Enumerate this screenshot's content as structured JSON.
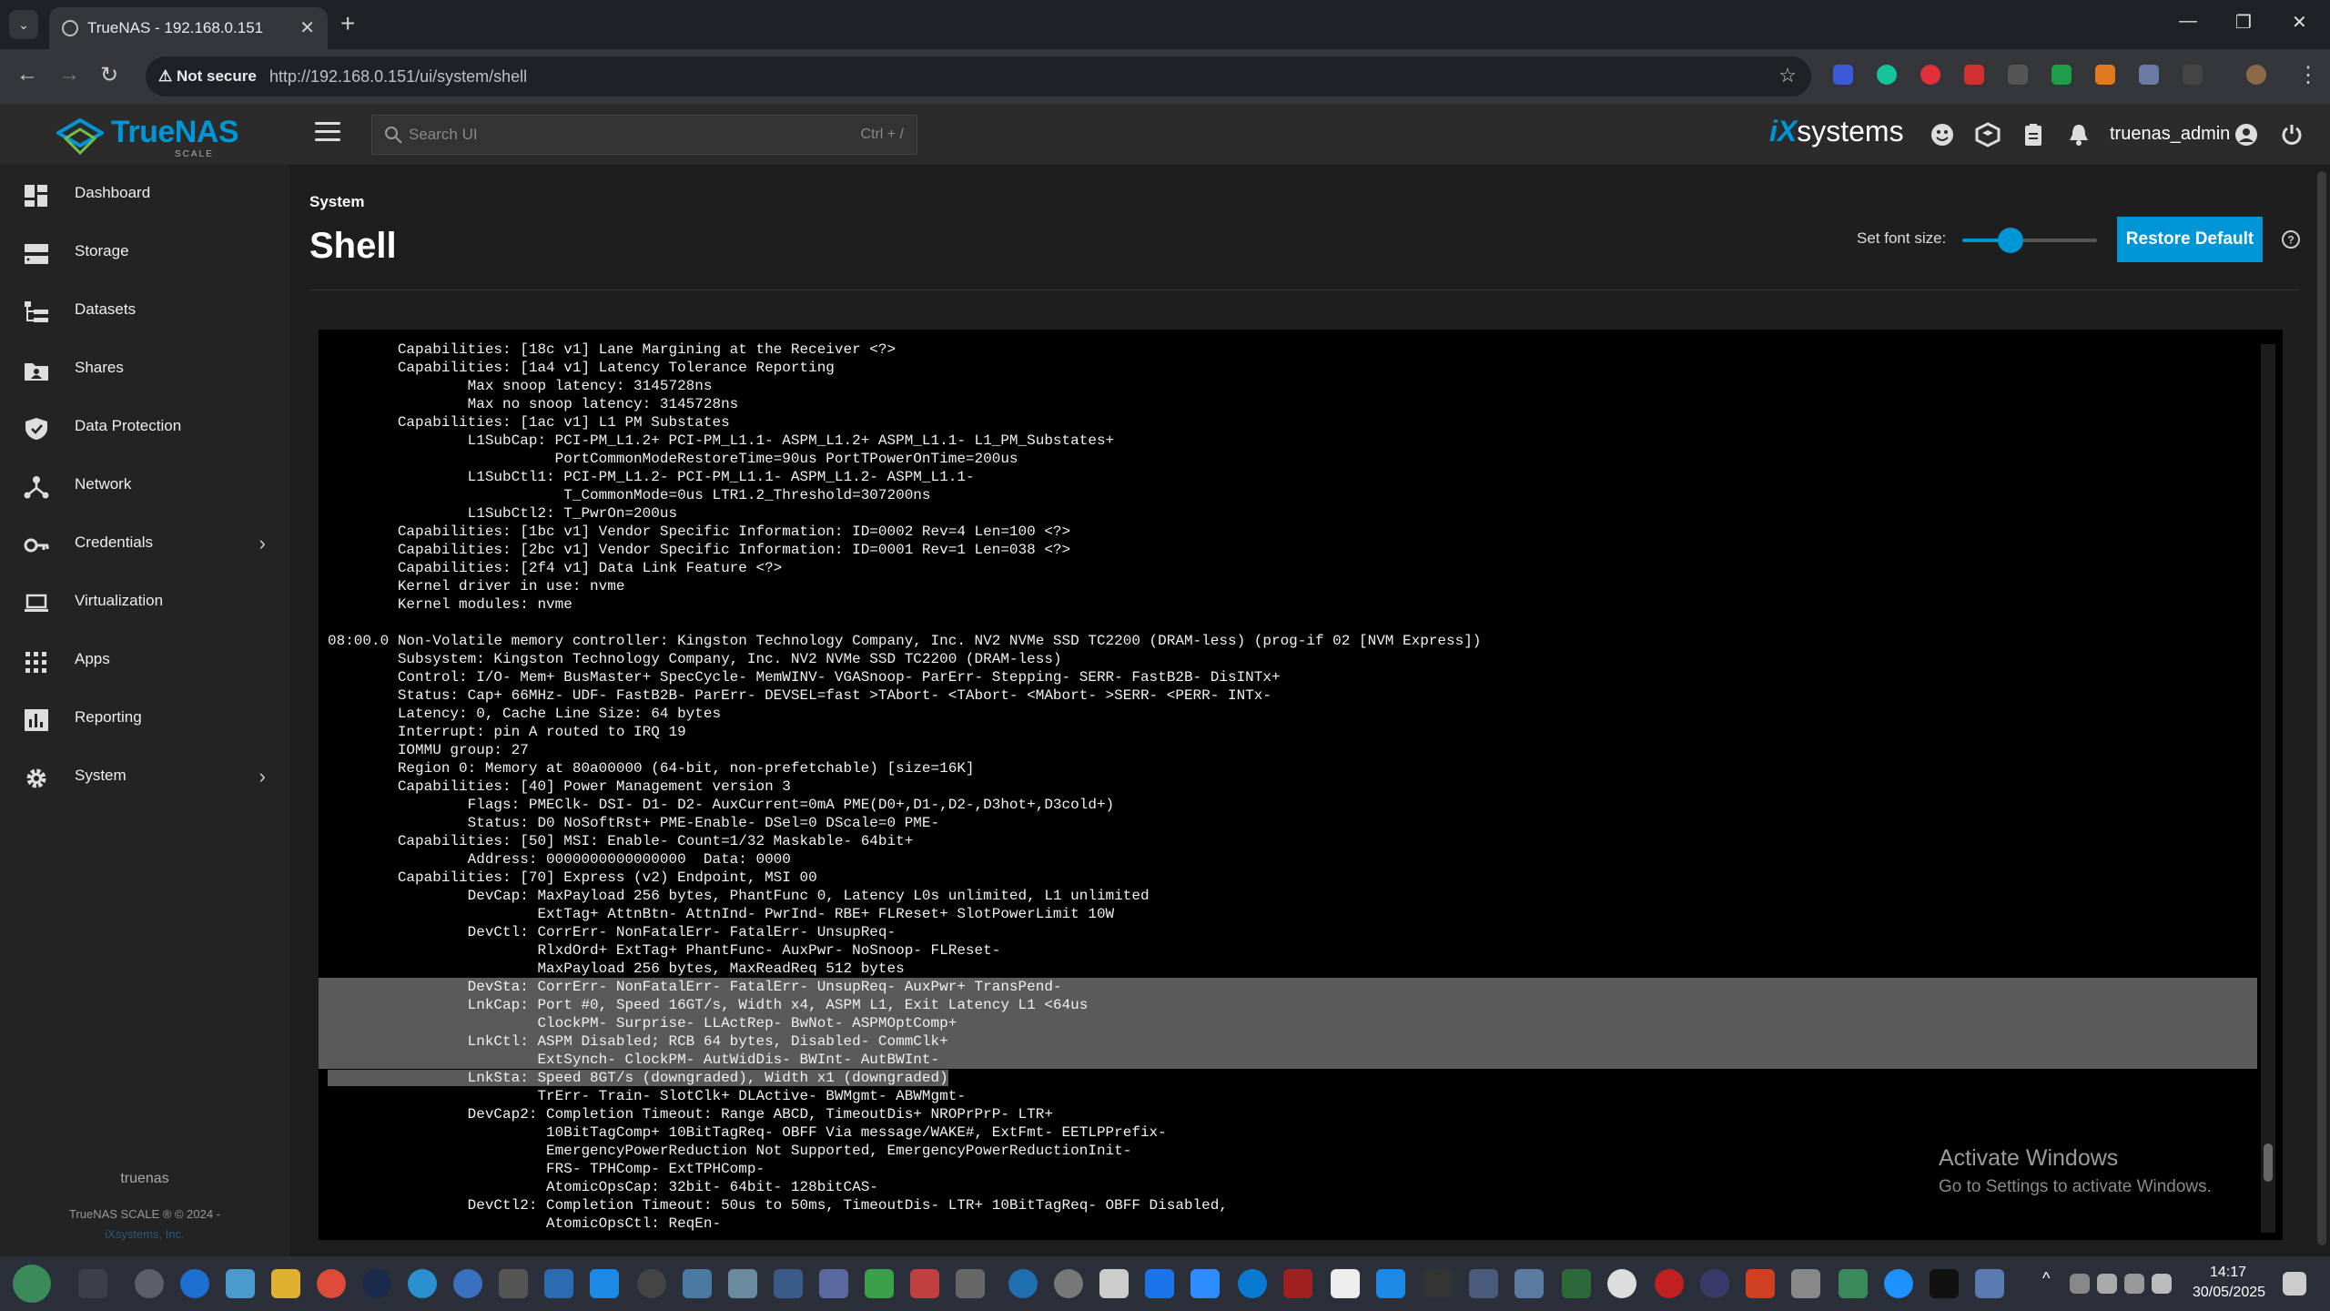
{
  "browser": {
    "tab_title": "TrueNAS - 192.168.0.151",
    "security_label": "Not secure",
    "url": "http://192.168.0.151/ui/system/shell"
  },
  "header": {
    "logo_text": "TrueNAS",
    "logo_sub": "SCALE",
    "search_placeholder": "Search UI",
    "search_shortcut": "Ctrl + /",
    "vendor_logo_prefix": "iX",
    "vendor_logo_suffix": "systems",
    "username": "truenas_admin"
  },
  "sidebar": {
    "items": [
      {
        "label": "Dashboard"
      },
      {
        "label": "Storage"
      },
      {
        "label": "Datasets"
      },
      {
        "label": "Shares"
      },
      {
        "label": "Data Protection"
      },
      {
        "label": "Network"
      },
      {
        "label": "Credentials"
      },
      {
        "label": "Virtualization"
      },
      {
        "label": "Apps"
      },
      {
        "label": "Reporting"
      },
      {
        "label": "System"
      }
    ],
    "hostname": "truenas",
    "copyright": "TrueNAS SCALE ® © 2024 -",
    "company": "iXsystems, Inc."
  },
  "page": {
    "breadcrumb": "System",
    "title": "Shell",
    "font_size_label": "Set font size:",
    "font_size_slider_fraction": 0.36,
    "restore_button": "Restore Default"
  },
  "terminal": {
    "lines": [
      "        Capabilities: [18c v1] Lane Margining at the Receiver <?>",
      "        Capabilities: [1a4 v1] Latency Tolerance Reporting",
      "                Max snoop latency: 3145728ns",
      "                Max no snoop latency: 3145728ns",
      "        Capabilities: [1ac v1] L1 PM Substates",
      "                L1SubCap: PCI-PM_L1.2+ PCI-PM_L1.1- ASPM_L1.2+ ASPM_L1.1- L1_PM_Substates+",
      "                          PortCommonModeRestoreTime=90us PortTPowerOnTime=200us",
      "                L1SubCtl1: PCI-PM_L1.2- PCI-PM_L1.1- ASPM_L1.2- ASPM_L1.1-",
      "                           T_CommonMode=0us LTR1.2_Threshold=307200ns",
      "                L1SubCtl2: T_PwrOn=200us",
      "        Capabilities: [1bc v1] Vendor Specific Information: ID=0002 Rev=4 Len=100 <?>",
      "        Capabilities: [2bc v1] Vendor Specific Information: ID=0001 Rev=1 Len=038 <?>",
      "        Capabilities: [2f4 v1] Data Link Feature <?>",
      "        Kernel driver in use: nvme",
      "        Kernel modules: nvme",
      "",
      "08:00.0 Non-Volatile memory controller: Kingston Technology Company, Inc. NV2 NVMe SSD TC2200 (DRAM-less) (prog-if 02 [NVM Express])",
      "        Subsystem: Kingston Technology Company, Inc. NV2 NVMe SSD TC2200 (DRAM-less)",
      "        Control: I/O- Mem+ BusMaster+ SpecCycle- MemWINV- VGASnoop- ParErr- Stepping- SERR- FastB2B- DisINTx+",
      "        Status: Cap+ 66MHz- UDF- FastB2B- ParErr- DEVSEL=fast >TAbort- <TAbort- <MAbort- >SERR- <PERR- INTx-",
      "        Latency: 0, Cache Line Size: 64 bytes",
      "        Interrupt: pin A routed to IRQ 19",
      "        IOMMU group: 27",
      "        Region 0: Memory at 80a00000 (64-bit, non-prefetchable) [size=16K]",
      "        Capabilities: [40] Power Management version 3",
      "                Flags: PMEClk- DSI- D1- D2- AuxCurrent=0mA PME(D0+,D1-,D2-,D3hot+,D3cold+)",
      "                Status: D0 NoSoftRst+ PME-Enable- DSel=0 DScale=0 PME-",
      "        Capabilities: [50] MSI: Enable- Count=1/32 Maskable- 64bit+",
      "                Address: 0000000000000000  Data: 0000",
      "        Capabilities: [70] Express (v2) Endpoint, MSI 00",
      "                DevCap: MaxPayload 256 bytes, PhantFunc 0, Latency L0s unlimited, L1 unlimited",
      "                        ExtTag+ AttnBtn- AttnInd- PwrInd- RBE+ FLReset+ SlotPowerLimit 10W",
      "                DevCtl: CorrErr- NonFatalErr- FatalErr- UnsupReq-",
      "                        RlxdOrd+ ExtTag+ PhantFunc- AuxPwr- NoSnoop- FLReset-",
      "                        MaxPayload 256 bytes, MaxReadReq 512 bytes",
      "                DevSta: CorrErr- NonFatalErr- FatalErr- UnsupReq- AuxPwr+ TransPend-",
      "                LnkCap: Port #0, Speed 16GT/s, Width x4, ASPM L1, Exit Latency L1 <64us",
      "                        ClockPM- Surprise- LLActRep- BwNot- ASPMOptComp+",
      "                LnkCtl: ASPM Disabled; RCB 64 bytes, Disabled- CommClk+",
      "                        ExtSynch- ClockPM- AutWidDis- BWInt- AutBWInt-",
      "                LnkSta: Speed 8GT/s (downgraded), Width x1 (downgraded)",
      "                        TrErr- Train- SlotClk+ DLActive- BWMgmt- ABWMgmt-",
      "                DevCap2: Completion Timeout: Range ABCD, TimeoutDis+ NROPrPrP- LTR+",
      "                         10BitTagComp+ 10BitTagReq- OBFF Via message/WAKE#, ExtFmt- EETLPPrefix-",
      "                         EmergencyPowerReduction Not Supported, EmergencyPowerReductionInit-",
      "                         FRS- TPHComp- ExtTPHComp-",
      "                         AtomicOpsCap: 32bit- 64bit- 128bitCAS-",
      "                DevCtl2: Completion Timeout: 50us to 50ms, TimeoutDis- LTR+ 10BitTagReq- OBFF Disabled,",
      "                         AtomicOpsCtl: ReqEn-"
    ],
    "selected_full_lines": [
      35,
      36,
      37,
      38,
      39
    ],
    "selected_partial_line": 40
  },
  "watermark": {
    "title": "Activate Windows",
    "subtitle": "Go to Settings to activate Windows."
  },
  "taskbar": {
    "time": "14:17",
    "date": "30/05/2025"
  },
  "colors": {
    "accent": "#0095d5",
    "terminal_bg": "#000000",
    "selection": "#5a5a5a"
  }
}
